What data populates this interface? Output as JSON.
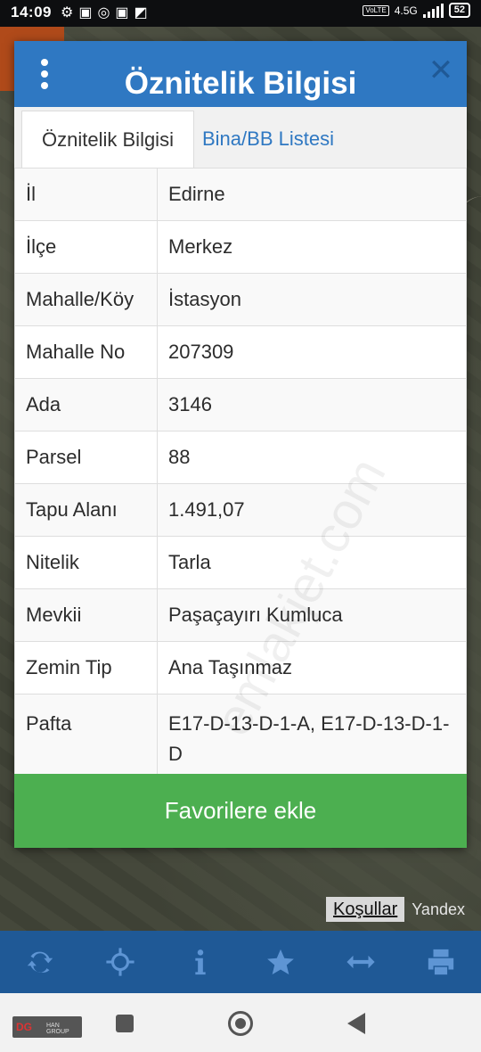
{
  "status_bar": {
    "time": "14:09",
    "left_icons": [
      "settings-icon",
      "nfc-icon",
      "instagram-icon",
      "gallery-icon",
      "app-icon"
    ],
    "volte": "VoLTE",
    "network": "4.5G",
    "battery": "52"
  },
  "dialog": {
    "title": "Öznitelik Bilgisi",
    "tabs": [
      {
        "label": "Öznitelik Bilgisi",
        "active": true
      },
      {
        "label": "Bina/BB Listesi",
        "active": false
      }
    ],
    "rows": [
      {
        "key": "İl",
        "value": "Edirne"
      },
      {
        "key": "İlçe",
        "value": "Merkez"
      },
      {
        "key": "Mahalle/Köy",
        "value": "İstasyon"
      },
      {
        "key": "Mahalle No",
        "value": "207309"
      },
      {
        "key": "Ada",
        "value": "3146"
      },
      {
        "key": "Parsel",
        "value": "88"
      },
      {
        "key": "Tapu Alanı",
        "value": "1.491,07"
      },
      {
        "key": "Nitelik",
        "value": "Tarla"
      },
      {
        "key": "Mevkii",
        "value": "Paşaçayırı Kumluca"
      },
      {
        "key": "Zemin Tip",
        "value": "Ana Taşınmaz"
      },
      {
        "key": "Pafta",
        "value": "E17-D-13-D-1-A,  E17-D-13-D-1-D"
      }
    ],
    "favorite_button": "Favorilere ekle"
  },
  "watermark": "emlakjet.com",
  "map": {
    "terms": "Koşullar",
    "provider": "Yandex"
  },
  "toolbar": {
    "icons": [
      "refresh-icon",
      "locate-icon",
      "info-icon",
      "star-icon",
      "measure-icon",
      "print-icon"
    ]
  },
  "navbar": {
    "brand": "HAN GROUP"
  },
  "colors": {
    "header": "#2f78c2",
    "toolbar": "#1f5996",
    "button": "#4caf50"
  }
}
